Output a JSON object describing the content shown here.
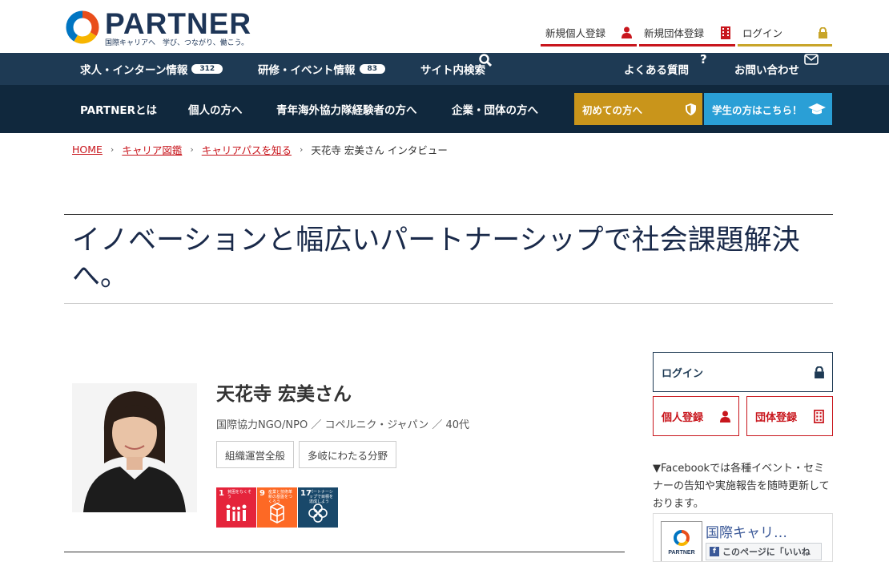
{
  "logo": {
    "word": "PARTNER",
    "tagline": "国際キャリアへ　学び、つながり、働こう。"
  },
  "header_links": [
    {
      "label": "新規個人登録",
      "icon": "person-icon"
    },
    {
      "label": "新規団体登録",
      "icon": "building-icon"
    },
    {
      "label": "ログイン",
      "icon": "lock-icon"
    }
  ],
  "nav1": {
    "jobs": {
      "label": "求人・インターン情報",
      "count": "312"
    },
    "events": {
      "label": "研修・イベント情報",
      "count": "83"
    },
    "search": "サイト内検索",
    "faq": "よくある質問",
    "contact": "お問い合わせ"
  },
  "nav2": {
    "about": "PARTNERとは",
    "individual": "個人の方へ",
    "jocv": "青年海外協力隊経験者の方へ",
    "orgs": "企業・団体の方へ",
    "first": "初めての方へ",
    "students": "学生の方はこちら！"
  },
  "breadcrumb": {
    "home": "HOME",
    "atlas": "キャリア図鑑",
    "path": "キャリアパスを知る",
    "current": "天花寺 宏美さん インタビュー"
  },
  "article": {
    "title": "イノベーションと幅広いパートナーシップで社会課題解決へ。"
  },
  "profile": {
    "name": "天花寺 宏美さん",
    "meta": "国際協力NGO/NPO ／ コペルニク・ジャパン ／ 40代",
    "tags": [
      "組織運営全般",
      "多岐にわたる分野"
    ],
    "sdgs": [
      {
        "num": "1",
        "text": "貧困をなくそう",
        "color": "#e5243b"
      },
      {
        "num": "9",
        "text": "産業と技術革新の基盤をつくろう",
        "color": "#fd6925"
      },
      {
        "num": "17",
        "text": "パートナーシップで目標を達成しよう",
        "color": "#19486a"
      }
    ]
  },
  "sidebar": {
    "login": "ログイン",
    "register_individual": "個人登録",
    "register_org": "団体登録",
    "fb_note": "▼Facebookでは各種イベント・セミナーの告知や実施報告を随時更新しております。",
    "fb_page_name": "国際キャリ…",
    "fb_like": "このページに「いいね",
    "fb_logo_text": "PARTNER"
  }
}
